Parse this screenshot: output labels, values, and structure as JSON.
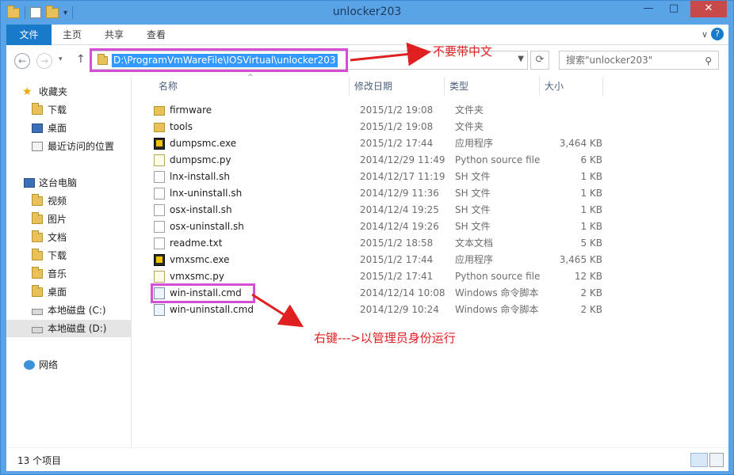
{
  "window": {
    "title": "unlocker203",
    "minimize": "—",
    "maximize": "□",
    "close": "✕"
  },
  "ribbon": {
    "tabs": [
      "文件",
      "主页",
      "共享",
      "查看"
    ]
  },
  "address": {
    "path": "D:\\ProgramVmWareFile\\IOSVirtual\\unlocker203",
    "search_placeholder": "搜索\"unlocker203\""
  },
  "sidebar": {
    "favorites": "收藏夹",
    "fav_items": [
      "下载",
      "桌面",
      "最近访问的位置"
    ],
    "pc": "这台电脑",
    "pc_items": [
      "视频",
      "图片",
      "文档",
      "下载",
      "音乐",
      "桌面",
      "本地磁盘 (C:)",
      "本地磁盘 (D:)"
    ],
    "network": "网络"
  },
  "columns": {
    "name": "名称",
    "date": "修改日期",
    "type": "类型",
    "size": "大小"
  },
  "files": [
    {
      "name": "firmware",
      "date": "2015/1/2 19:08",
      "type": "文件夹",
      "size": "",
      "icon": "folder-icon"
    },
    {
      "name": "tools",
      "date": "2015/1/2 19:08",
      "type": "文件夹",
      "size": "",
      "icon": "folder-icon"
    },
    {
      "name": "dumpsmc.exe",
      "date": "2015/1/2 17:44",
      "type": "应用程序",
      "size": "3,464 KB",
      "icon": "exe-icon"
    },
    {
      "name": "dumpsmc.py",
      "date": "2014/12/29 11:49",
      "type": "Python source file",
      "size": "6 KB",
      "icon": "python-file-icon"
    },
    {
      "name": "lnx-install.sh",
      "date": "2014/12/17 11:19",
      "type": "SH 文件",
      "size": "1 KB",
      "icon": "file-icon"
    },
    {
      "name": "lnx-uninstall.sh",
      "date": "2014/12/9 11:36",
      "type": "SH 文件",
      "size": "1 KB",
      "icon": "file-icon"
    },
    {
      "name": "osx-install.sh",
      "date": "2014/12/4 19:25",
      "type": "SH 文件",
      "size": "1 KB",
      "icon": "file-icon"
    },
    {
      "name": "osx-uninstall.sh",
      "date": "2014/12/4 19:26",
      "type": "SH 文件",
      "size": "1 KB",
      "icon": "file-icon"
    },
    {
      "name": "readme.txt",
      "date": "2015/1/2 18:58",
      "type": "文本文档",
      "size": "5 KB",
      "icon": "text-file-icon"
    },
    {
      "name": "vmxsmc.exe",
      "date": "2015/1/2 17:44",
      "type": "应用程序",
      "size": "3,465 KB",
      "icon": "exe-icon"
    },
    {
      "name": "vmxsmc.py",
      "date": "2015/1/2 17:41",
      "type": "Python source file",
      "size": "12 KB",
      "icon": "python-file-icon"
    },
    {
      "name": "win-install.cmd",
      "date": "2014/12/14 10:08",
      "type": "Windows 命令脚本",
      "size": "2 KB",
      "icon": "cmd-file-icon"
    },
    {
      "name": "win-uninstall.cmd",
      "date": "2014/12/9 10:24",
      "type": "Windows 命令脚本",
      "size": "2 KB",
      "icon": "cmd-file-icon"
    }
  ],
  "annotations": {
    "address_note": "不要带中文",
    "install_note": "右键--->以管理员身份运行",
    "color": "#e02020",
    "highlight_color": "#d44fd4"
  },
  "status": {
    "count": "13 个项目"
  }
}
